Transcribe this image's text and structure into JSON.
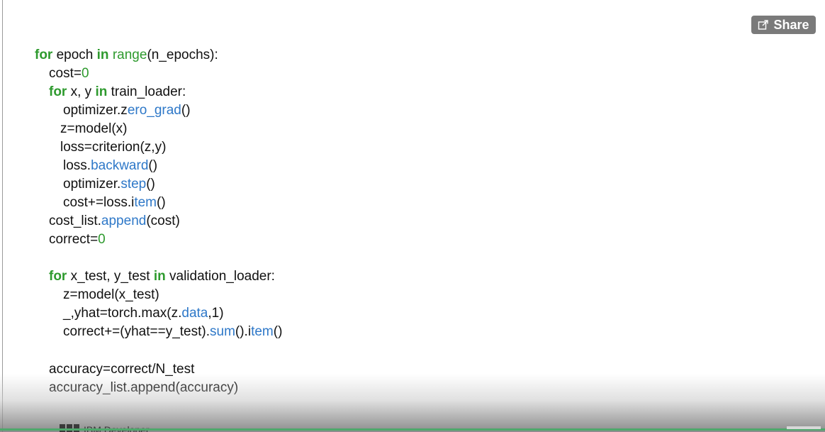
{
  "share_label": "Share",
  "watermark_text": "IBM Developer",
  "colors": {
    "keyword": "#2e9a2e",
    "function": "#2e78c8",
    "number": "#2e9a2e",
    "text": "#111111",
    "share_bg": "#7a7a7a",
    "progress": "#4ea86b"
  },
  "code_lines": [
    [
      {
        "t": "for",
        "c": "kw"
      },
      {
        "t": " epoch "
      },
      {
        "t": "in",
        "c": "kw"
      },
      {
        "t": " "
      },
      {
        "t": "range",
        "c": "kw-lite"
      },
      {
        "t": "(n_epochs):"
      }
    ],
    [
      {
        "t": "cost="
      },
      {
        "t": "0",
        "c": "num"
      }
    ],
    [
      {
        "t": "for",
        "c": "kw"
      },
      {
        "t": " x, y "
      },
      {
        "t": "in",
        "c": "kw"
      },
      {
        "t": " train_loader:"
      }
    ],
    [
      {
        "t": "optimizer.z"
      },
      {
        "t": "ero_grad",
        "c": "fn"
      },
      {
        "t": "()"
      }
    ],
    [
      {
        "t": "z=model(x)"
      }
    ],
    [
      {
        "t": "loss=criterion(z,y)"
      }
    ],
    [
      {
        "t": "loss."
      },
      {
        "t": "backward",
        "c": "fn"
      },
      {
        "t": "()"
      }
    ],
    [
      {
        "t": "optimizer."
      },
      {
        "t": "step",
        "c": "fn"
      },
      {
        "t": "()"
      }
    ],
    [
      {
        "t": "cost+=loss.i"
      },
      {
        "t": "tem",
        "c": "fn"
      },
      {
        "t": "()"
      }
    ],
    [
      {
        "t": "cost_list."
      },
      {
        "t": "append",
        "c": "fn"
      },
      {
        "t": "(cost)"
      }
    ],
    [
      {
        "t": "correct="
      },
      {
        "t": "0",
        "c": "num"
      }
    ],
    [],
    [
      {
        "t": "for",
        "c": "kw"
      },
      {
        "t": " x_test, y_test "
      },
      {
        "t": "in",
        "c": "kw"
      },
      {
        "t": " validation_loader:"
      }
    ],
    [
      {
        "t": "z=model(x_test)"
      }
    ],
    [
      {
        "t": "_,yhat=torch.max(z."
      },
      {
        "t": "data",
        "c": "fn"
      },
      {
        "t": ",1)"
      }
    ],
    [
      {
        "t": "correct+=(yhat==y_test)."
      },
      {
        "t": "sum",
        "c": "fn"
      },
      {
        "t": "().i"
      },
      {
        "t": "tem",
        "c": "fn"
      },
      {
        "t": "()"
      }
    ],
    [],
    [
      {
        "t": "accuracy=correct/N_test"
      }
    ],
    [
      {
        "t": "accuracy_list.append(accuracy)"
      }
    ]
  ]
}
